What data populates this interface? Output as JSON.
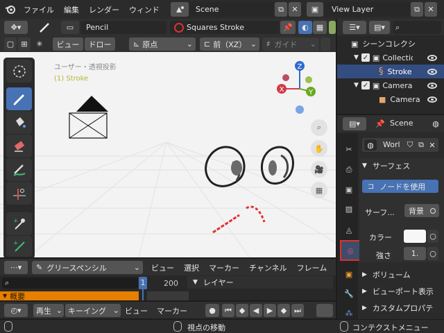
{
  "topbar": {
    "menus": [
      "ファイル",
      "編集",
      "レンダー",
      "ウィンド"
    ],
    "scene": "Scene",
    "view_layer": "View Layer"
  },
  "viewport_header": {
    "brush": "Pencil",
    "stroke_material": "Squares Stroke",
    "view": "ビュー",
    "draw": "ドロー",
    "origin": "原点",
    "plane": "前（XZ）",
    "guide": "ガイド"
  },
  "viewport": {
    "overlay_title": "ユーザー・透視投影",
    "overlay_object": "(1) Stroke",
    "gizmo": {
      "z": "Z",
      "y": "Y",
      "x": "X"
    }
  },
  "outliner": {
    "items": [
      {
        "label": "シーンコレクシ"
      },
      {
        "label": "Collectio"
      },
      {
        "label": "Stroke"
      },
      {
        "label": "Camera"
      },
      {
        "label": "Camera"
      }
    ]
  },
  "properties": {
    "scene_label": "Scene",
    "world_name": "Worl",
    "panel_surface": "サーフェス",
    "use_nodes": "ノードを使用",
    "surface_label": "サーフ...",
    "surface_value": "背景",
    "color_label": "カラー",
    "strength_label": "強さ",
    "strength_value": "1.",
    "volume": "ボリューム",
    "viewport_display": "ビューポート表示",
    "custom_props": "カスタムプロパテ"
  },
  "dopesheet": {
    "mode": "グリースペンシル",
    "menus": [
      "ビュー",
      "選択",
      "マーカー",
      "チャンネル",
      "フレーム"
    ],
    "frame_current": "1",
    "frame_marker": "200",
    "layer_label": "レイヤー",
    "summary": "概要"
  },
  "timeline": {
    "playback": "再生",
    "keying": "キーイング",
    "view": "ビュー",
    "marker": "マーカー"
  },
  "statusbar": {
    "left": "視点の移動",
    "right": "コンテクストメニュー"
  },
  "colors": {
    "accent": "#4772b3",
    "selection": "#334d80",
    "highlight_border": "#e0302a",
    "orange": "#e67e00"
  }
}
